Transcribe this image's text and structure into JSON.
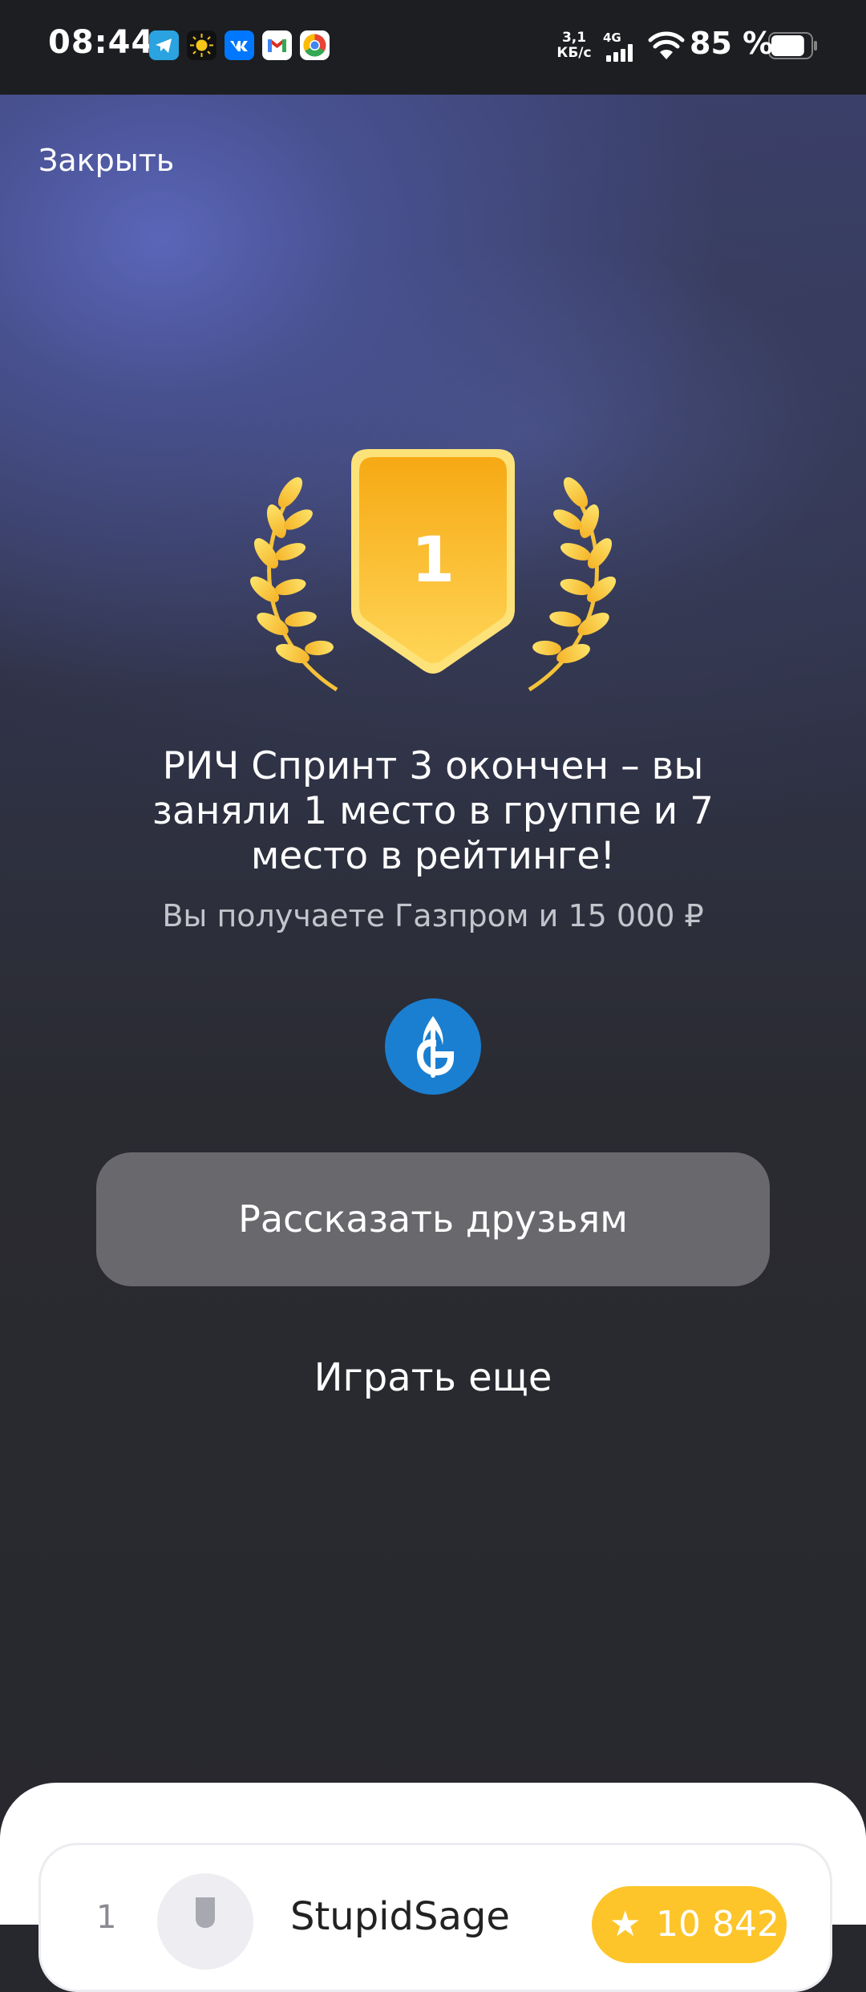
{
  "status_bar": {
    "time": "08:44",
    "net_speed_value": "3,1",
    "net_speed_unit": "КБ/с",
    "network_type": "4G",
    "battery_percent": "85 %",
    "battery_level": 0.85,
    "app_icons": [
      "telegram-icon",
      "sun-app-icon",
      "vk-icon",
      "gmail-icon",
      "chrome-icon"
    ]
  },
  "header": {
    "close_label": "Закрыть"
  },
  "achievement": {
    "place_number": "1",
    "title": "РИЧ Спринт 3 окончен – вы заняли 1 место в группе и 7 место в рейтинге!",
    "reward_text": "Вы получаете Газпром и 15 000 ₽",
    "brand_icon": "gazprom-logo-icon"
  },
  "actions": {
    "share_label": "Рассказать друзьям",
    "play_again_label": "Играть еще"
  },
  "leaderboard": {
    "rows": [
      {
        "rank": "1",
        "name": "StupidSage",
        "score": "10 842"
      }
    ]
  },
  "colors": {
    "accent_gold": "#fdc52a",
    "gazprom_blue": "#1a7fd1",
    "button_gray": "#68686d"
  }
}
